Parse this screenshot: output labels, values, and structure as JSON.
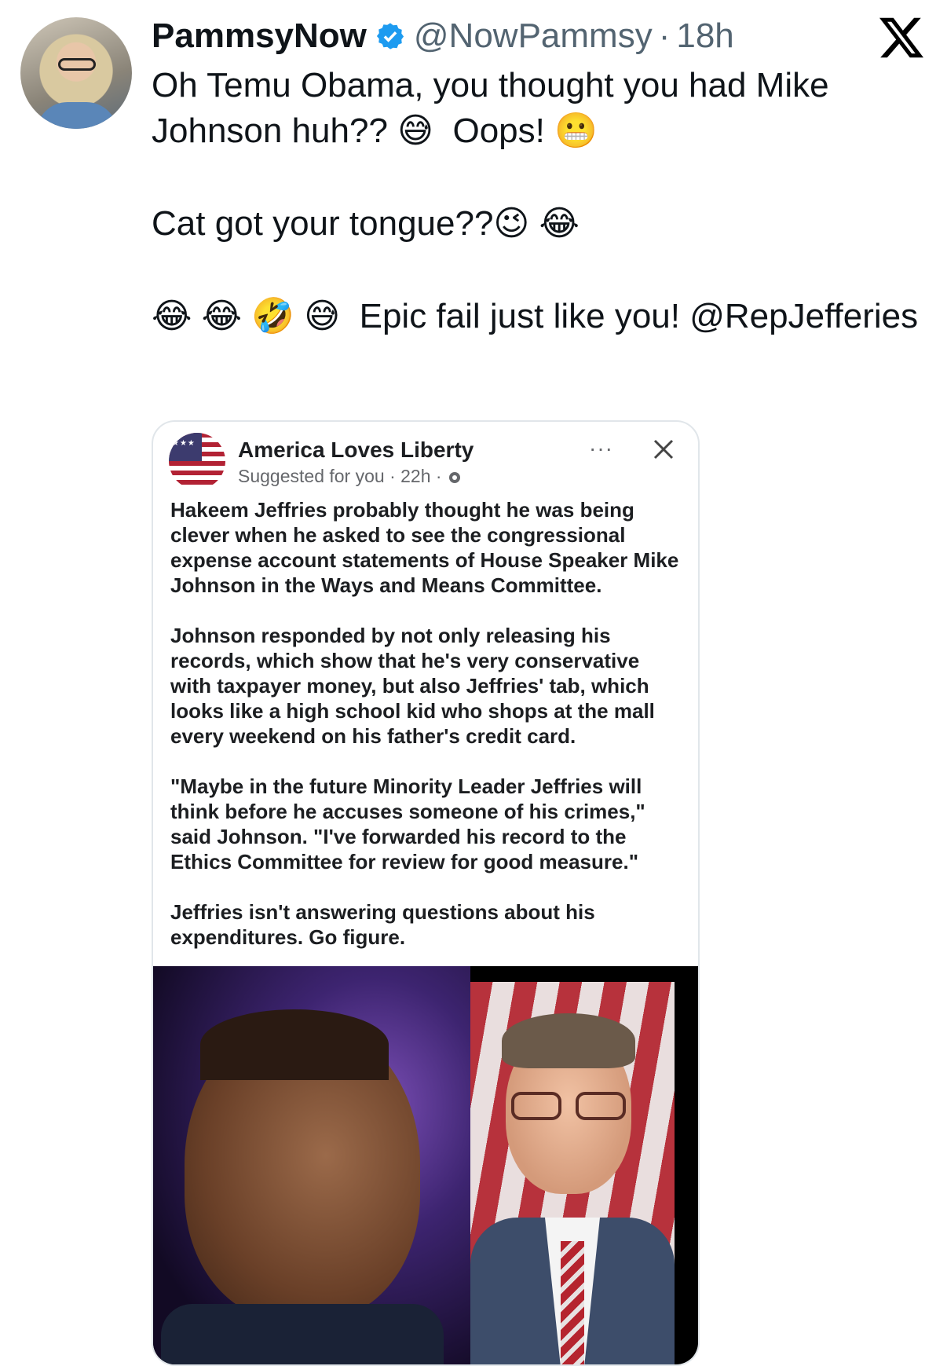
{
  "tweet": {
    "author_name": "PammsyNow",
    "handle": "@NowPammsy",
    "separator": "·",
    "time": "18h",
    "lines": [
      "Oh Temu Obama, you thought you had Mike Johnson huh?? 😅  Oops! 😬",
      "Cat got your tongue??😉 😂",
      "😂 😂 🤣 😅  Epic fail just like you! @RepJefferies"
    ]
  },
  "icons": {
    "verified": "verified-badge-icon",
    "platform_logo": "x-logo-icon"
  },
  "embedded_post": {
    "page_name": "America Loves Liberty",
    "suggested": "Suggested for you",
    "time": "22h",
    "more": "···",
    "paragraphs": [
      "Hakeem Jeffries probably thought he was being clever when he asked to see the congressional expense account statements of House Speaker Mike Johnson in the Ways and Means Committee.",
      "Johnson responded by not only releasing his records, which show that he's very conservative with taxpayer money, but also Jeffries' tab, which looks like a high school kid who shops at the mall every weekend on his father's credit card.",
      "\"Maybe in the future Minority Leader Jeffries will think before he accuses someone of his crimes,\" said Johnson. \"I've forwarded his record to the Ethics Committee for review for good measure.\"",
      "Jeffries isn't answering questions about his expenditures. Go figure."
    ]
  },
  "colors": {
    "verified_blue": "#1d9bf0",
    "text_primary": "#0f1419",
    "text_secondary": "#536471"
  }
}
